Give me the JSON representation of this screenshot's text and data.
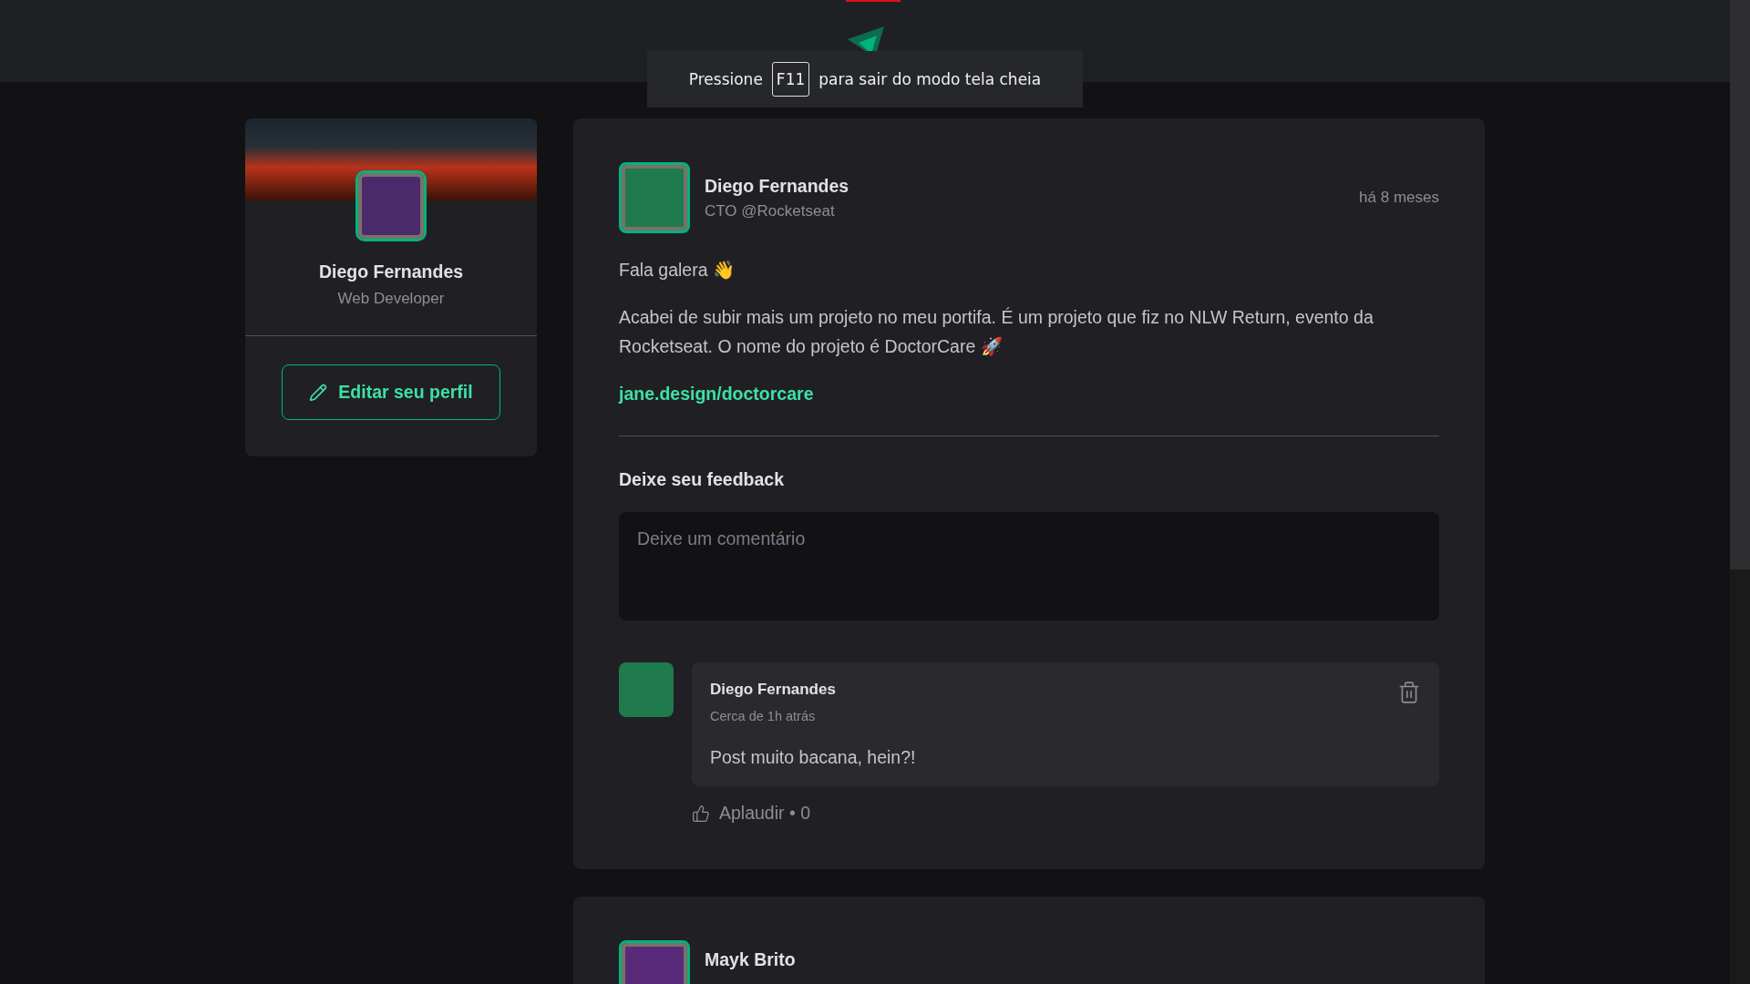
{
  "browser": {
    "fullscreen_notice": {
      "before": "Pressione",
      "key": "F11",
      "after": "para sair do modo tela cheia"
    }
  },
  "sidebar": {
    "name": "Diego Fernandes",
    "role": "Web Developer",
    "edit_button": "Editar seu perfil"
  },
  "posts": [
    {
      "author": {
        "name": "Diego Fernandes",
        "role": "CTO @Rocketseat"
      },
      "time": "há 8 meses",
      "content": [
        {
          "kind": "paragraph",
          "text": "Fala galera 👋"
        },
        {
          "kind": "paragraph",
          "text": "Acabei de subir mais um projeto no meu portifa. É um projeto que fiz no NLW Return, evento da Rocketseat. O nome do projeto é DoctorCare 🚀"
        },
        {
          "kind": "link",
          "text": "jane.design/doctorcare"
        }
      ],
      "feedback": {
        "title": "Deixe seu feedback",
        "placeholder": "Deixe um comentário"
      },
      "comments": [
        {
          "author": "Diego Fernandes",
          "time": "Cerca de 1h atrás",
          "text": "Post muito bacana, hein?!",
          "applaud": "Aplaudir • 0"
        }
      ]
    },
    {
      "author": {
        "name": "Mayk Brito"
      }
    }
  ]
}
